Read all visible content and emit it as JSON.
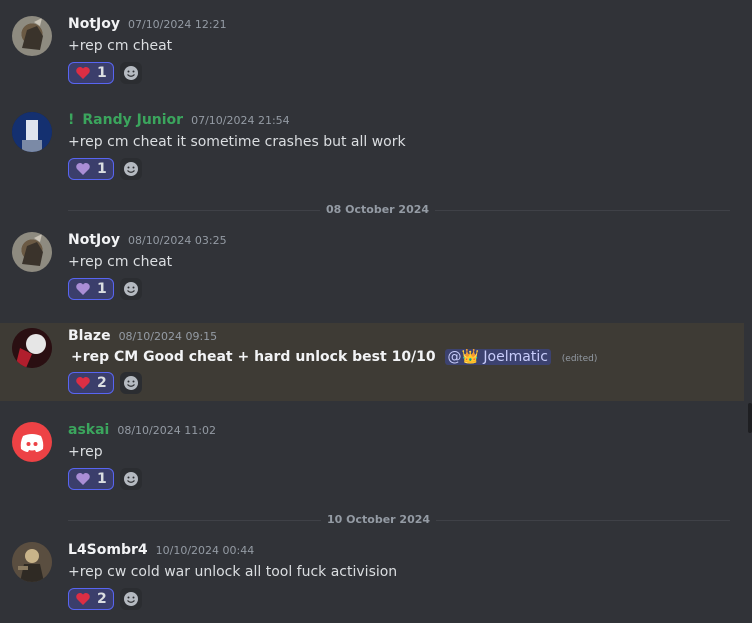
{
  "messages": [
    {
      "username": "NotJoy",
      "timestamp": "07/10/2024 12:21",
      "text": "+rep cm cheat",
      "reaction": {
        "emoji": "heart-red",
        "count": "1"
      }
    },
    {
      "username_prefix": "!",
      "username": "Randy Junior",
      "timestamp": "07/10/2024 21:54",
      "text": "+rep cm cheat it sometime crashes but all work",
      "reaction": {
        "emoji": "heart-purple",
        "count": "1"
      }
    },
    {
      "username": "NotJoy",
      "timestamp": "08/10/2024 03:25",
      "text": "+rep cm cheat",
      "reaction": {
        "emoji": "heart-purple",
        "count": "1"
      }
    },
    {
      "username": "Blaze",
      "timestamp": "08/10/2024 09:15",
      "text": "+rep CM Good cheat + hard unlock best 10/10",
      "mention": "@👑 Joelmatic",
      "edited": "(edited)",
      "reaction": {
        "emoji": "heart-red",
        "count": "2"
      }
    },
    {
      "username": "askai",
      "timestamp": "08/10/2024 11:02",
      "text": "+rep",
      "reaction": {
        "emoji": "heart-purple",
        "count": "1"
      }
    },
    {
      "username": "L4Sombr4",
      "timestamp": "10/10/2024 00:44",
      "text": "+rep cw cold war unlock all tool fuck activision",
      "reaction": {
        "emoji": "heart-red",
        "count": "2"
      }
    }
  ],
  "dividers": [
    "08 October 2024",
    "10 October 2024"
  ],
  "colors": {
    "heart_red": "#dd2e44",
    "heart_purple": "#aa8ed6",
    "green_name": "#3ba55d",
    "accent": "#5865f2",
    "discord_red": "#ed4245"
  }
}
